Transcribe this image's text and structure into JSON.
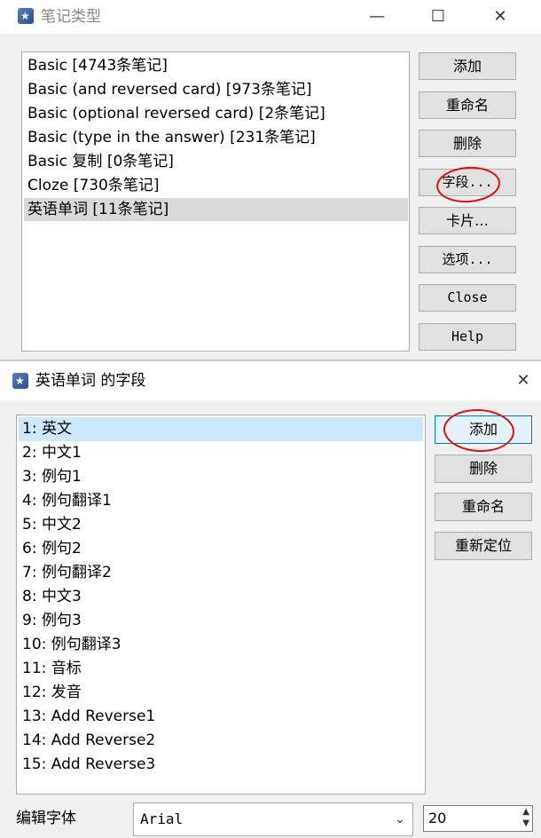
{
  "note_types_window": {
    "title": "笔记类型",
    "items": [
      "Basic [4743条笔记]",
      "Basic (and reversed card) [973条笔记]",
      "Basic (optional reversed card) [2条笔记]",
      "Basic (type in the answer) [231条笔记]",
      "Basic 复制 [0条笔记]",
      "Cloze [730条笔记]",
      "英语单词 [11条笔记]"
    ],
    "selected_index": 6,
    "buttons": {
      "add": "添加",
      "rename": "重命名",
      "delete": "删除",
      "fields": "字段...",
      "cards": "卡片…",
      "options": "选项...",
      "close": "Close",
      "help": "Help"
    }
  },
  "fields_window": {
    "title": "英语单词 的字段",
    "fields": [
      "1: 英文",
      "2: 中文1",
      "3: 例句1",
      "4: 例句翻译1",
      "5: 中文2",
      "6: 例句2",
      "7: 例句翻译2",
      "8: 中文3",
      "9: 例句3",
      "10: 例句翻译3",
      "11: 音标",
      "12: 发音",
      "13: Add Reverse1",
      "14: Add Reverse2",
      "15: Add Reverse3"
    ],
    "selected_index": 0,
    "buttons": {
      "add": "添加",
      "delete": "删除",
      "rename": "重命名",
      "reposition": "重新定位"
    },
    "editor_font_label": "编辑字体",
    "font_value": "Arial",
    "font_size_value": "20"
  },
  "colors": {
    "selection_gray": "#d9d9d9",
    "selection_blue": "#cce8ff",
    "annotation_red": "#e01010"
  }
}
